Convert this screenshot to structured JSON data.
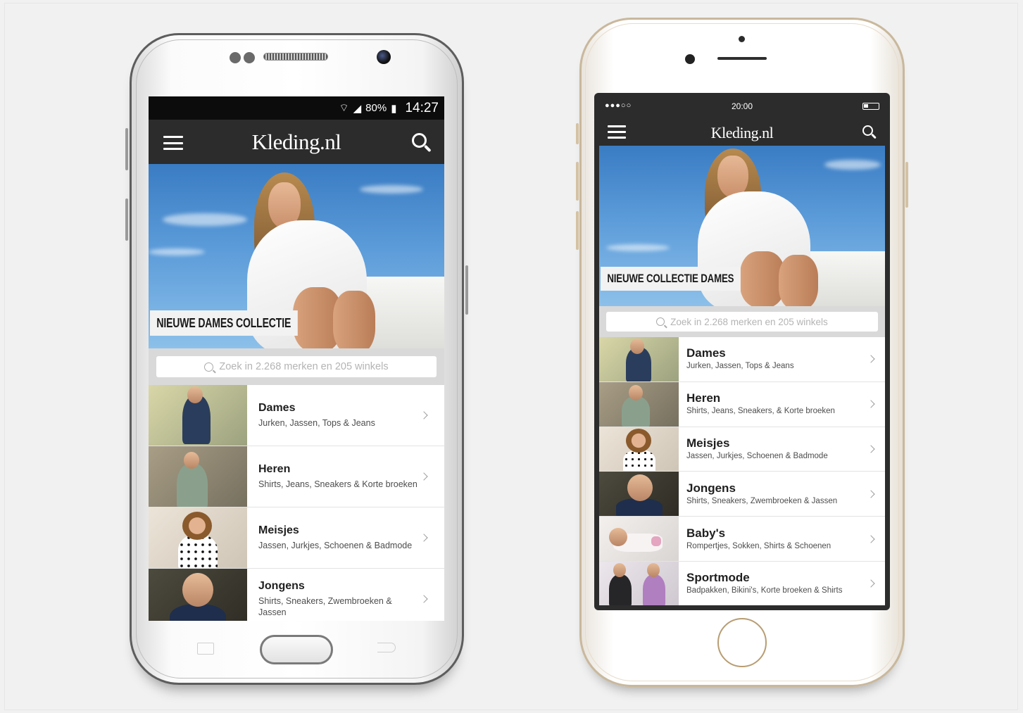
{
  "android": {
    "status": {
      "signal_text": "80%",
      "time": "14:27"
    },
    "brand": "Kleding.nl",
    "hero_label": "NIEUWE DAMES COLLECTIE",
    "search_placeholder": "Zoek in 2.268 merken en 205 winkels",
    "categories": [
      {
        "title": "Dames",
        "subtitle": "Jurken, Jassen, Tops & Jeans"
      },
      {
        "title": "Heren",
        "subtitle": "Shirts, Jeans, Sneakers & Korte broeken"
      },
      {
        "title": "Meisjes",
        "subtitle": "Jassen, Jurkjes, Schoenen & Badmode"
      },
      {
        "title": "Jongens",
        "subtitle": "Shirts, Sneakers, Zwembroeken & Jassen"
      }
    ]
  },
  "ios": {
    "status": {
      "signal_dots": "●●●○○",
      "time": "20:00"
    },
    "brand": "Kleding.nl",
    "hero_label": "NIEUWE COLLECTIE DAMES",
    "search_placeholder": "Zoek in 2.268 merken en 205 winkels",
    "categories": [
      {
        "title": "Dames",
        "subtitle": "Jurken, Jassen, Tops & Jeans"
      },
      {
        "title": "Heren",
        "subtitle": "Shirts, Jeans, Sneakers, & Korte broeken"
      },
      {
        "title": "Meisjes",
        "subtitle": "Jassen, Jurkjes, Schoenen & Badmode"
      },
      {
        "title": "Jongens",
        "subtitle": "Shirts, Sneakers, Zwembroeken & Jassen"
      },
      {
        "title": "Baby's",
        "subtitle": "Rompertjes, Sokken, Shirts & Schoenen"
      },
      {
        "title": "Sportmode",
        "subtitle": "Badpakken, Bikini's, Korte broeken & Shirts"
      }
    ]
  },
  "colors": {
    "header": "#2c2c2c",
    "sky": "#4a8ad0",
    "divider": "#e3e3e3"
  }
}
